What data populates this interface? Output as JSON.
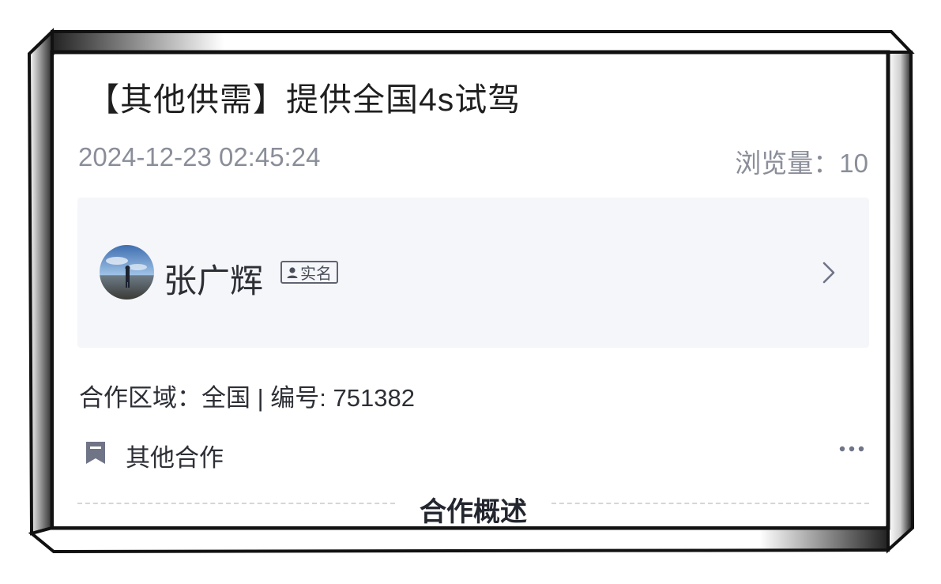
{
  "post": {
    "title": "【其他供需】提供全国4s试驾",
    "date": "2024-12-23 02:45:24",
    "views_label": "浏览量：10"
  },
  "user": {
    "name": "张广辉",
    "badge": "实名",
    "avatar_icon": "avatar-photo",
    "arrow_icon": "chevron-right-icon"
  },
  "details": {
    "region_line": "合作区域：全国 | 编号: 751382",
    "category": "其他合作",
    "category_icon": "bookmark-icon",
    "more_icon": "more-dots-icon"
  },
  "section": {
    "title": "合作概述"
  },
  "colors": {
    "panel_bg": "#f5f6fa",
    "muted_text": "#8a8e99",
    "body_text": "#2d2f36",
    "icon_gray": "#6f7486"
  }
}
